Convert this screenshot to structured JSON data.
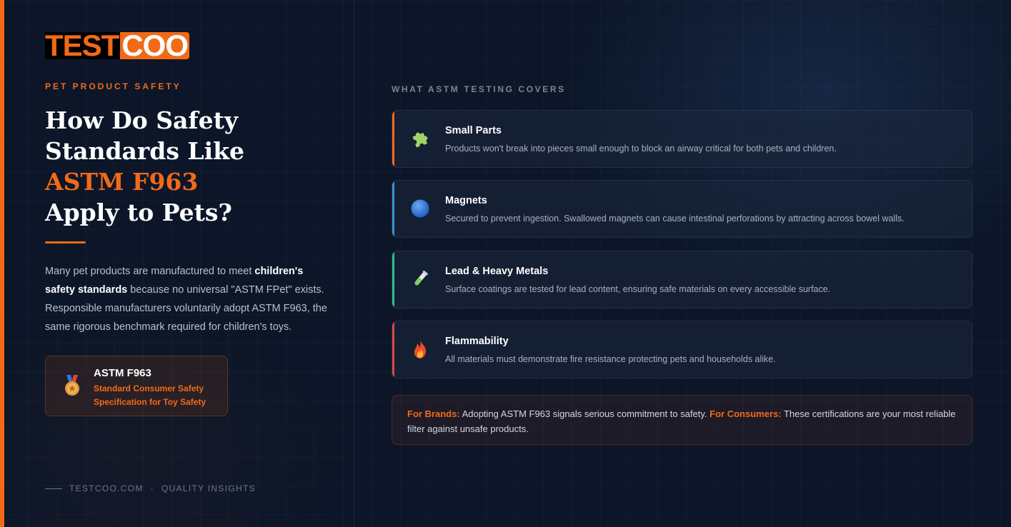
{
  "brand": {
    "logo_part1": "TEST",
    "logo_part2": "COO",
    "accent_color": "#f26a17"
  },
  "left": {
    "eyebrow": "PET PRODUCT SAFETY",
    "headline": {
      "line1": "How Do Safety",
      "line2": "Standards Like",
      "highlight": "ASTM F963",
      "line4": "Apply to Pets?"
    },
    "intro": {
      "part1": "Many pet products are manufactured to meet ",
      "bold1": "children's safety standards",
      "part2": " because no universal \"ASTM FPet\" exists. Responsible manufacturers voluntarily adopt ASTM F963, the same rigorous benchmark required for children's toys."
    },
    "badge": {
      "icon": "medal-icon",
      "title": "ASTM F963",
      "subtitle": "Standard Consumer Safety Specification for Toy Safety"
    },
    "footer": {
      "site": "TESTCOO.COM",
      "separator": "·",
      "tagline": "QUALITY INSIGHTS"
    }
  },
  "right": {
    "section_label": "WHAT ASTM TESTING COVERS",
    "cards": [
      {
        "icon": "puzzle-piece-icon",
        "title": "Small Parts",
        "description": "Products won't break into pieces small enough to block an airway critical for both pets and children.",
        "accent": "#f26a17"
      },
      {
        "icon": "blue-circle-icon",
        "title": "Magnets",
        "description": "Secured to prevent ingestion. Swallowed magnets can cause intestinal perforations by attracting across bowel walls.",
        "accent": "#3a8fd8"
      },
      {
        "icon": "test-tube-icon",
        "title": "Lead & Heavy Metals",
        "description": "Surface coatings are tested for lead content, ensuring safe materials on every accessible surface.",
        "accent": "#2fbf8a"
      },
      {
        "icon": "fire-icon",
        "title": "Flammability",
        "description": "All materials must demonstrate fire resistance protecting pets and households alike.",
        "accent": "#d94848"
      }
    ],
    "callout": {
      "brands_label": "For Brands:",
      "brands_text": " Adopting ASTM F963 signals serious commitment to safety. ",
      "consumers_label": "For Consumers:",
      "consumers_text": " These certifications are your most reliable filter against unsafe products."
    }
  }
}
